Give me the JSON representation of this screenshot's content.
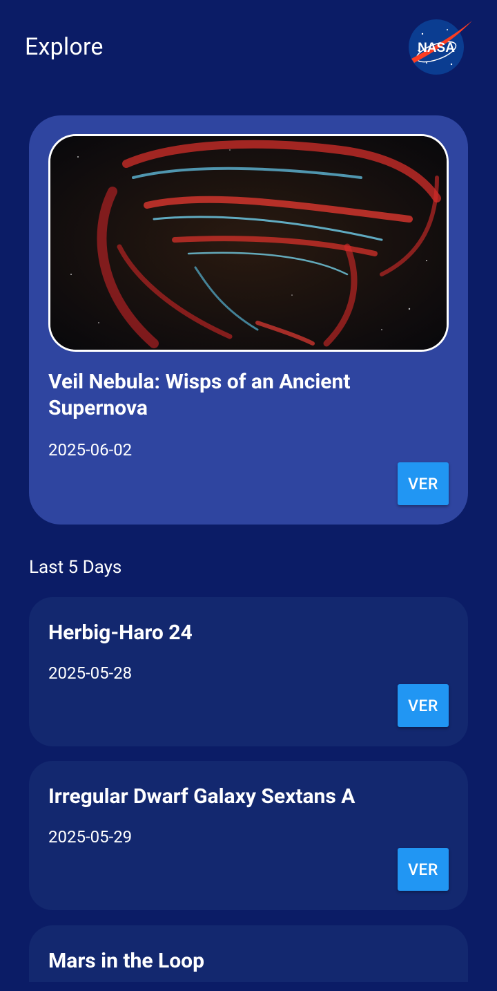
{
  "header": {
    "title": "Explore",
    "logo_text": "NASA",
    "logo_icon": "nasa-meatball-logo"
  },
  "featured": {
    "title": "Veil Nebula: Wisps of an Ancient Supernova",
    "date": "2025-06-02",
    "button_label": "VER",
    "image_icon": "veil-nebula-photo"
  },
  "recent": {
    "section_label": "Last 5 Days",
    "items": [
      {
        "title": "Herbig-Haro 24",
        "date": "2025-05-28",
        "button_label": "VER"
      },
      {
        "title": "Irregular Dwarf Galaxy Sextans A",
        "date": "2025-05-29",
        "button_label": "VER"
      },
      {
        "title": "Mars in the Loop"
      }
    ]
  },
  "colors": {
    "background": "#0b1c66",
    "hero_card": "#2f45a0",
    "list_card": "#13286f",
    "button": "#2196f3",
    "text": "#ffffff"
  }
}
